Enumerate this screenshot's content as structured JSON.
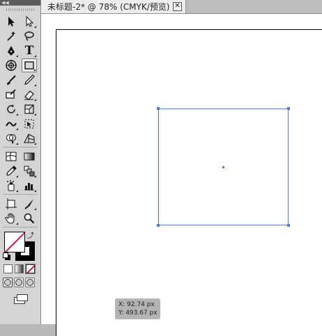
{
  "tab": {
    "title": "未标题-2* @ 78% (CMYK/预览)",
    "close_glyph": "✕"
  },
  "toolbar": {
    "collapse_glyph": "◀◀",
    "tools": [
      [
        "selection-tool",
        "direct-selection-tool"
      ],
      [
        "magic-wand-tool",
        "lasso-tool"
      ],
      [
        "pen-tool",
        "type-tool"
      ],
      [
        "line-segment-tool",
        "rectangle-tool"
      ],
      [
        "paintbrush-tool",
        "pencil-tool"
      ],
      [
        "blob-brush-tool",
        "eraser-tool"
      ],
      [
        "rotate-tool",
        "scale-tool"
      ],
      [
        "width-tool",
        "free-transform-tool"
      ],
      [
        "shape-builder-tool",
        "perspective-grid-tool"
      ],
      [
        "mesh-tool",
        "gradient-tool"
      ],
      [
        "eyedropper-tool",
        "blend-tool"
      ],
      [
        "symbol-sprayer-tool",
        "column-graph-tool"
      ],
      [
        "artboard-tool",
        "slice-tool"
      ],
      [
        "hand-tool",
        "zoom-tool"
      ]
    ],
    "selected_tool": "rectangle-tool",
    "type_tool_glyph": "T"
  },
  "colors": {
    "fill": "none",
    "stroke": "#000000",
    "selection": "#4a7cf0",
    "none_slash": "#d3134a"
  },
  "coordinates": {
    "x": "X: 92.74 px",
    "y": "Y: 493.67 px"
  }
}
